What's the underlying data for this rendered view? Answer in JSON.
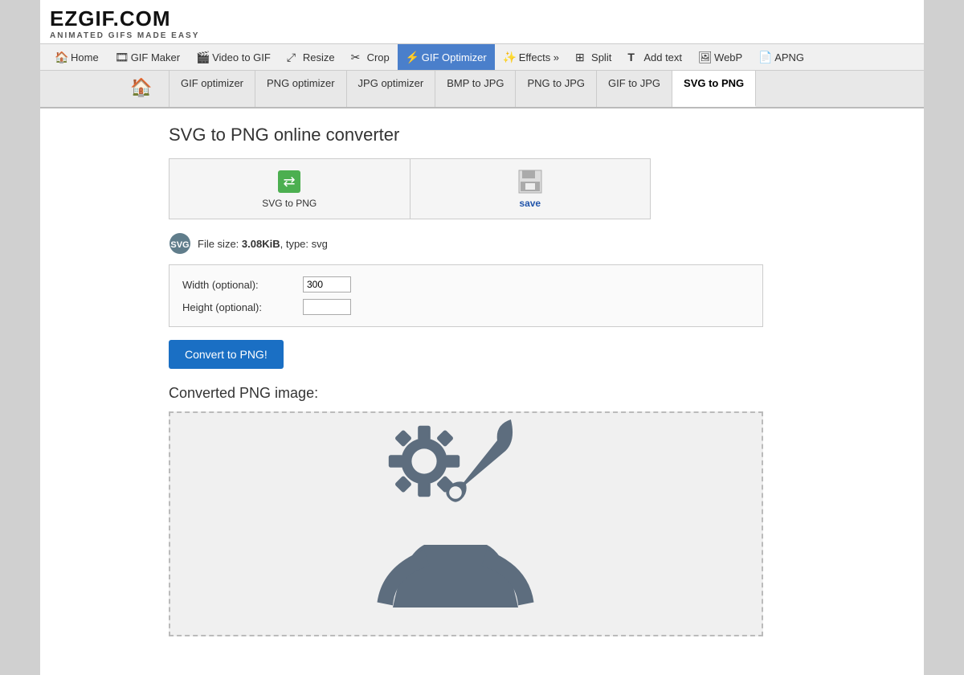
{
  "logo": {
    "name": "EZGIF.COM",
    "tagline": "ANIMATED GIFS MADE EASY"
  },
  "navbar": {
    "items": [
      {
        "id": "home",
        "label": "Home",
        "icon": "🏠"
      },
      {
        "id": "gif-maker",
        "label": "GIF Maker",
        "icon": "🎞"
      },
      {
        "id": "video-to-gif",
        "label": "Video to GIF",
        "icon": "🎬"
      },
      {
        "id": "resize",
        "label": "Resize",
        "icon": "⤢"
      },
      {
        "id": "crop",
        "label": "Crop",
        "icon": "✂"
      },
      {
        "id": "gif-optimizer",
        "label": "GIF Optimizer",
        "icon": "⚡",
        "active": true
      },
      {
        "id": "effects",
        "label": "Effects »",
        "icon": "✨"
      },
      {
        "id": "split",
        "label": "Split",
        "icon": "⊞"
      },
      {
        "id": "add-text",
        "label": "Add text",
        "icon": "T"
      },
      {
        "id": "webp",
        "label": "WebP",
        "icon": "🖼"
      },
      {
        "id": "apng",
        "label": "APNG",
        "icon": "📄"
      }
    ]
  },
  "subnav": {
    "items": [
      {
        "id": "gif-optimizer",
        "label": "GIF optimizer"
      },
      {
        "id": "png-optimizer",
        "label": "PNG optimizer"
      },
      {
        "id": "jpg-optimizer",
        "label": "JPG optimizer"
      },
      {
        "id": "bmp-to-jpg",
        "label": "BMP to JPG"
      },
      {
        "id": "png-to-jpg",
        "label": "PNG to JPG"
      },
      {
        "id": "gif-to-jpg",
        "label": "GIF to JPG"
      },
      {
        "id": "svg-to-png",
        "label": "SVG to PNG",
        "active": true
      }
    ]
  },
  "page": {
    "title": "SVG to PNG online converter"
  },
  "toolbar": {
    "upload_label": "SVG to PNG",
    "save_label": "save"
  },
  "file_info": {
    "prefix": "File size: ",
    "size": "3.08KiB",
    "suffix": ", type: svg"
  },
  "options": {
    "width_label": "Width (optional):",
    "width_value": "300",
    "height_label": "Height (optional):",
    "height_value": ""
  },
  "convert_button": "Convert to PNG!",
  "converted_title": "Converted PNG image:",
  "preview": {
    "alt": "SVG tools icon"
  }
}
